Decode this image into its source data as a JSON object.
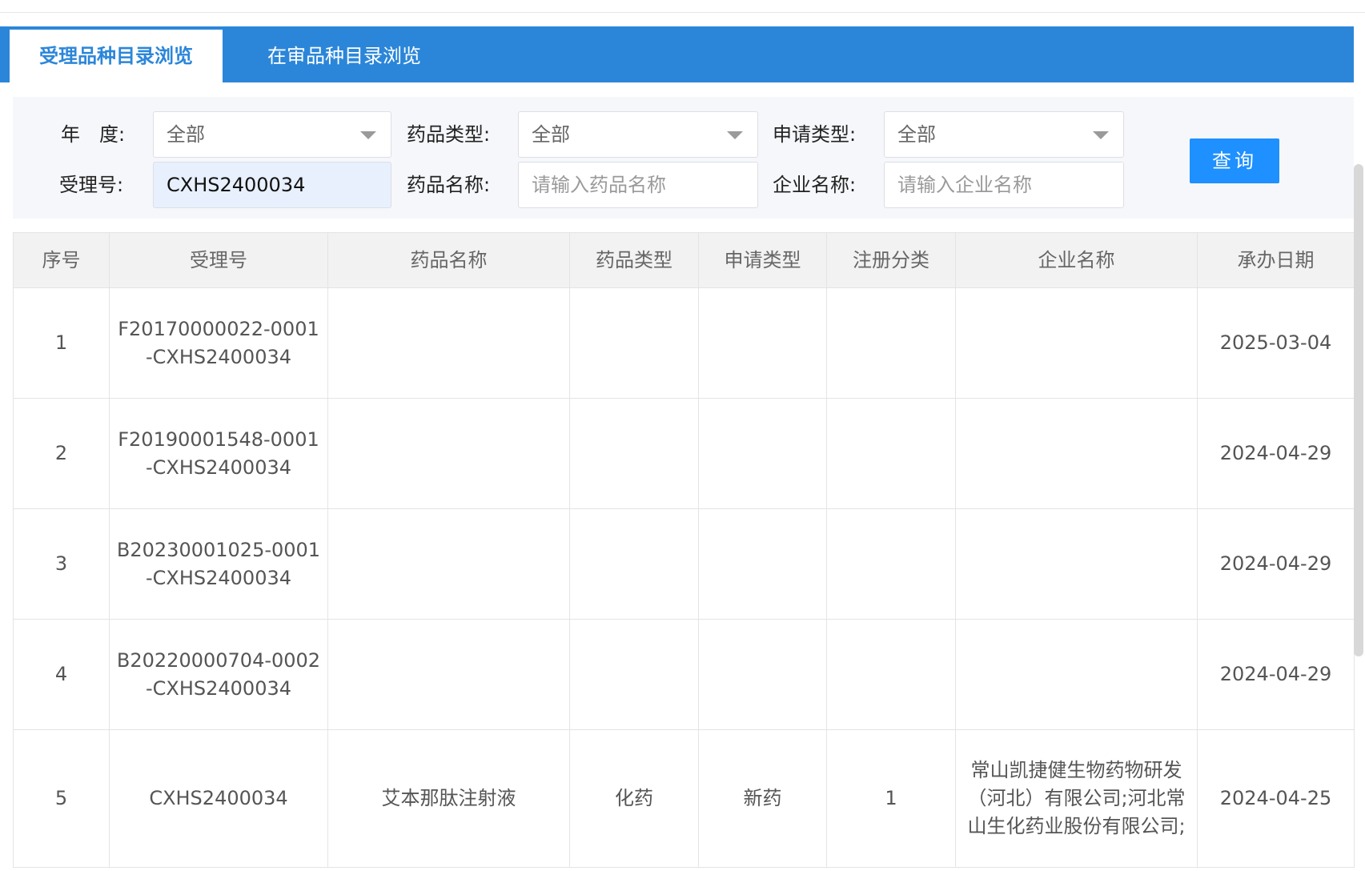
{
  "tabs": [
    {
      "label": "受理品种目录浏览",
      "active": true
    },
    {
      "label": "在审品种目录浏览",
      "active": false
    }
  ],
  "filters": {
    "year_label": "年　度:",
    "year_value": "全部",
    "drug_type_label": "药品类型:",
    "drug_type_value": "全部",
    "apply_type_label": "申请类型:",
    "apply_type_value": "全部",
    "accept_no_label": "受理号:",
    "accept_no_value": "CXHS2400034",
    "drug_name_label": "药品名称:",
    "drug_name_placeholder": "请输入药品名称",
    "company_label": "企业名称:",
    "company_placeholder": "请输入企业名称",
    "query_label": "查询"
  },
  "table": {
    "columns": [
      "序号",
      "受理号",
      "药品名称",
      "药品类型",
      "申请类型",
      "注册分类",
      "企业名称",
      "承办日期"
    ],
    "rows": [
      {
        "no": "1",
        "accept_no": "F20170000022-0001-CXHS2400034",
        "drug_name": "",
        "drug_type": "",
        "apply_type": "",
        "reg_class": "",
        "company": "",
        "date": "2025-03-04"
      },
      {
        "no": "2",
        "accept_no": "F20190001548-0001-CXHS2400034",
        "drug_name": "",
        "drug_type": "",
        "apply_type": "",
        "reg_class": "",
        "company": "",
        "date": "2024-04-29"
      },
      {
        "no": "3",
        "accept_no": "B20230001025-0001-CXHS2400034",
        "drug_name": "",
        "drug_type": "",
        "apply_type": "",
        "reg_class": "",
        "company": "",
        "date": "2024-04-29"
      },
      {
        "no": "4",
        "accept_no": "B20220000704-0002-CXHS2400034",
        "drug_name": "",
        "drug_type": "",
        "apply_type": "",
        "reg_class": "",
        "company": "",
        "date": "2024-04-29"
      },
      {
        "no": "5",
        "accept_no": "CXHS2400034",
        "drug_name": "艾本那肽注射液",
        "drug_type": "化药",
        "apply_type": "新药",
        "reg_class": "1",
        "company": "常山凯捷健生物药物研发（河北）有限公司;河北常山生化药业股份有限公司;",
        "date": "2024-04-25"
      }
    ]
  },
  "colors": {
    "tab_bar": "#2b86d9",
    "query_button": "#1e90ff",
    "filter_bg": "#f5f7fa",
    "header_bg": "#f2f2f2"
  }
}
